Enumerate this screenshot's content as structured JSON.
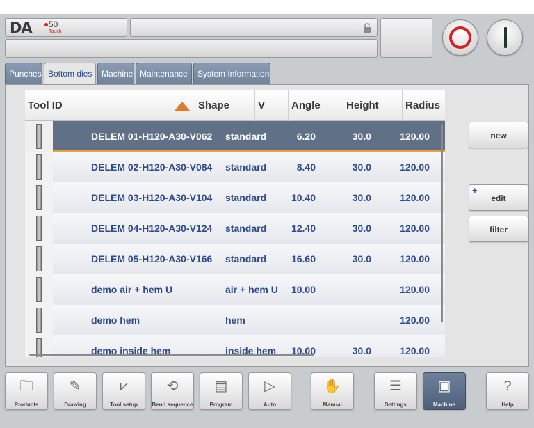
{
  "header": {
    "logo_text": "DA",
    "logo_model": "50",
    "logo_variant": "Touch",
    "stop_color": "#d42020",
    "start_color": "#1e3a26"
  },
  "tabs": [
    {
      "label": "Punches",
      "active": false
    },
    {
      "label": "Bottom dies",
      "active": true
    },
    {
      "label": "Machine",
      "active": false
    },
    {
      "label": "Maintenance",
      "active": false
    },
    {
      "label": "System Information",
      "active": false
    }
  ],
  "table": {
    "columns": [
      "Tool ID",
      "Shape",
      "V",
      "Angle",
      "Height",
      "Radius"
    ],
    "sort_column": "Tool ID",
    "sort_direction": "ascending",
    "accent_color": "#e07a2a",
    "selected_color": "#5f7087",
    "rows": [
      {
        "id": "DELEM 01-H120-A30-V062",
        "shape": "standard",
        "v": "6.20",
        "angle": "30.0",
        "height": "120.00",
        "selected": true
      },
      {
        "id": "DELEM 02-H120-A30-V084",
        "shape": "standard",
        "v": "8.40",
        "angle": "30.0",
        "height": "120.00",
        "selected": false
      },
      {
        "id": "DELEM 03-H120-A30-V104",
        "shape": "standard",
        "v": "10.40",
        "angle": "30.0",
        "height": "120.00",
        "selected": false
      },
      {
        "id": "DELEM 04-H120-A30-V124",
        "shape": "standard",
        "v": "12.40",
        "angle": "30.0",
        "height": "120.00",
        "selected": false
      },
      {
        "id": "DELEM 05-H120-A30-V166",
        "shape": "standard",
        "v": "16.60",
        "angle": "30.0",
        "height": "120.00",
        "selected": false
      },
      {
        "id": "demo air + hem U",
        "shape": "air + hem U",
        "v": "10.00",
        "angle": "",
        "height": "120.00",
        "selected": false
      },
      {
        "id": "demo hem",
        "shape": "hem",
        "v": "",
        "angle": "",
        "height": "120.00",
        "selected": false
      },
      {
        "id": "demo inside hem",
        "shape": "inside hem",
        "v": "10.00",
        "angle": "30.0",
        "height": "120.00",
        "selected": false
      }
    ]
  },
  "side_buttons": {
    "new": "new",
    "edit": "edit",
    "edit_plus": "+",
    "filter": "filter"
  },
  "bottom_nav": [
    {
      "label": "Products",
      "icon": "folder-icon",
      "glyph": "🗀",
      "active": false
    },
    {
      "label": "Drawing",
      "icon": "drawing-icon",
      "glyph": "✎",
      "active": false
    },
    {
      "label": "Tool setup",
      "icon": "tool-setup-icon",
      "glyph": "⩗",
      "active": false
    },
    {
      "label": "Bend sequence",
      "icon": "bend-sequence-icon",
      "glyph": "⟲",
      "active": false
    },
    {
      "label": "Program",
      "icon": "program-icon",
      "glyph": "▤",
      "active": false
    },
    {
      "label": "Auto",
      "icon": "play-icon",
      "glyph": "▷",
      "active": false
    },
    {
      "label": "Manual",
      "icon": "hand-icon",
      "glyph": "✋",
      "active": false
    },
    {
      "label": "Settings",
      "icon": "settings-icon",
      "glyph": "☰",
      "active": false
    },
    {
      "label": "Machine",
      "icon": "machine-icon",
      "glyph": "▣",
      "active": true
    },
    {
      "label": "Help",
      "icon": "help-icon",
      "glyph": "?",
      "active": false
    }
  ]
}
